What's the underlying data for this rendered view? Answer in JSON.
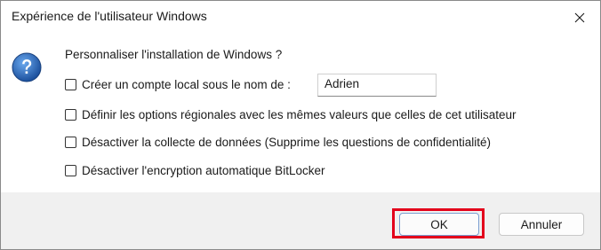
{
  "window": {
    "title": "Expérience de l'utilisateur Windows",
    "close_icon": "close-icon"
  },
  "dialog": {
    "icon": "question-icon",
    "prompt": "Personnaliser l'installation de Windows ?",
    "options": [
      {
        "label": "Créer un compte local sous le nom de :",
        "checked": false
      },
      {
        "label": "Définir les options régionales avec les mêmes valeurs que celles de cet utilisateur",
        "checked": false
      },
      {
        "label": "Désactiver la collecte de données (Supprime les questions de confidentialité)",
        "checked": false
      },
      {
        "label": "Désactiver l'encryption automatique BitLocker",
        "checked": false
      }
    ],
    "username_value": "Adrien"
  },
  "buttons": {
    "ok_label": "OK",
    "cancel_label": "Annuler"
  },
  "colors": {
    "highlight": "#e3001b",
    "accent": "#1f6fb8"
  }
}
